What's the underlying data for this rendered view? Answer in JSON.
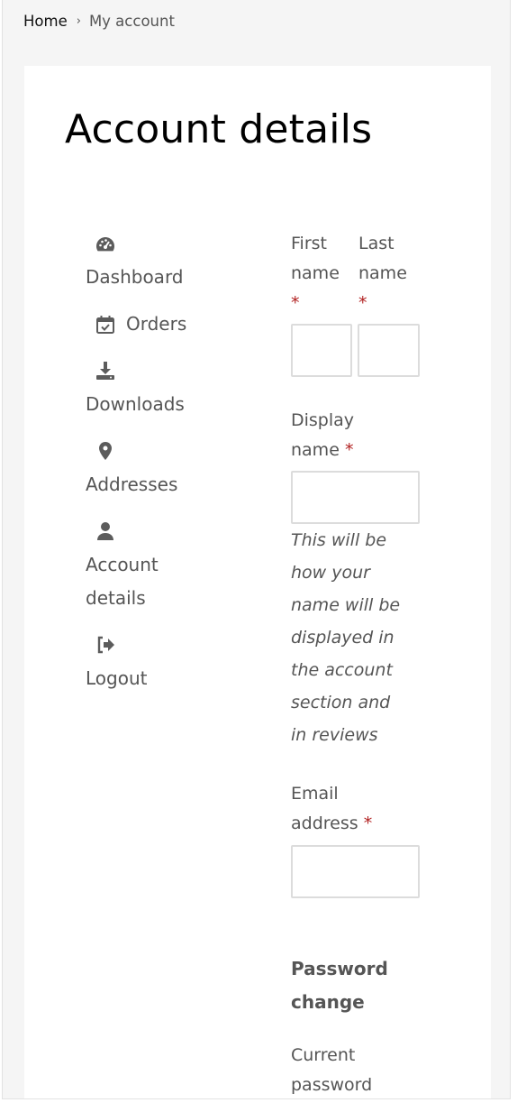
{
  "breadcrumb": {
    "home": "Home",
    "separator": "›",
    "current": "My account"
  },
  "page_title": "Account details",
  "nav": {
    "dashboard": "Dashboard",
    "orders": "Orders",
    "downloads": "Downloads",
    "addresses": "Addresses",
    "account_details_line1": "Account",
    "account_details_line2": "details",
    "logout": "Logout"
  },
  "icons": {
    "dashboard": "tachometer-icon",
    "orders": "calendar-check-icon",
    "downloads": "download-icon",
    "addresses": "map-marker-icon",
    "account_details": "user-icon",
    "logout": "sign-out-icon"
  },
  "form": {
    "first_name_l1": "First",
    "first_name_l2": "name",
    "last_name_l1": "Last",
    "last_name_l2": "name",
    "required_mark": "*",
    "display_name_l1": "Display",
    "display_name_l2": "name",
    "display_hint": [
      "This will be",
      "how your",
      "name will be",
      "displayed in",
      "the account",
      "section and",
      "in reviews"
    ],
    "email_l1": "Email",
    "email_l2": "address",
    "password_title_l1": "Password",
    "password_title_l2": "change",
    "current_pw_l1": "Current",
    "current_pw_l2": "password"
  },
  "colors": {
    "required": "#b22222",
    "text": "#555555",
    "background": "#f5f5f5"
  }
}
